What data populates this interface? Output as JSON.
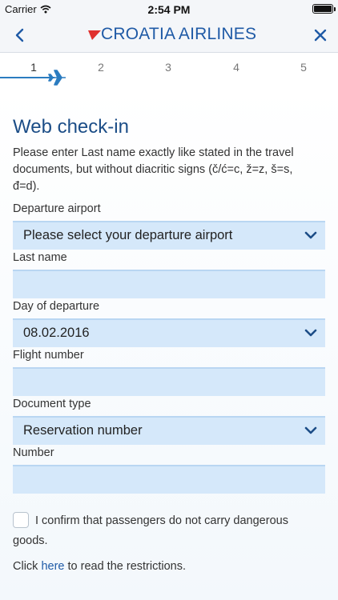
{
  "status_bar": {
    "carrier": "Carrier",
    "time": "2:54 PM"
  },
  "nav": {
    "brand": "CROATIA AIRLINES"
  },
  "steps": [
    "1",
    "2",
    "3",
    "4",
    "5"
  ],
  "form": {
    "title": "Web check-in",
    "intro": "Please enter Last name exactly like stated in the travel documents, but without diacritic signs (č/ć=c, ž=z, š=s, đ=d).",
    "departure_airport": {
      "label": "Departure airport",
      "value": "Please select your departure airport"
    },
    "last_name": {
      "label": "Last name",
      "value": ""
    },
    "day_of_departure": {
      "label": "Day of departure",
      "value": "08.02.2016"
    },
    "flight_number": {
      "label": "Flight number",
      "value": ""
    },
    "document_type": {
      "label": "Document type",
      "value": "Reservation number"
    },
    "number": {
      "label": "Number",
      "value": ""
    },
    "confirm_text": "I confirm that passengers do not carry dangerous goods.",
    "click_prefix": "Click ",
    "click_link": "here",
    "click_suffix": " to read the restrictions."
  },
  "colors": {
    "brand": "#1f5aa6",
    "field": "#d5e8fa",
    "accent_red": "#e0312f"
  }
}
